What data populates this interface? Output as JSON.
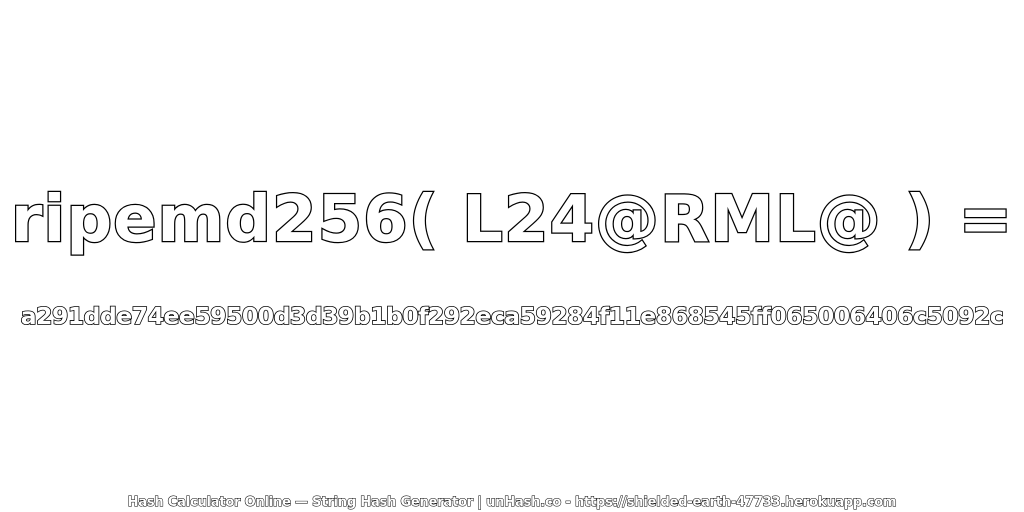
{
  "expression": "ripemd256( L24@RML@ ) =",
  "hash_value": "a291dde74ee59500d3d39b1b0f292eca59284f11e868545ff065006406c5092c",
  "footer": "Hash Calculator Online — String Hash Generator | unHash.co - https://shielded-earth-47733.herokuapp.com",
  "colors": {
    "background": "#ffffff",
    "text_fill": "#ffffff",
    "text_outline": "#000000"
  }
}
